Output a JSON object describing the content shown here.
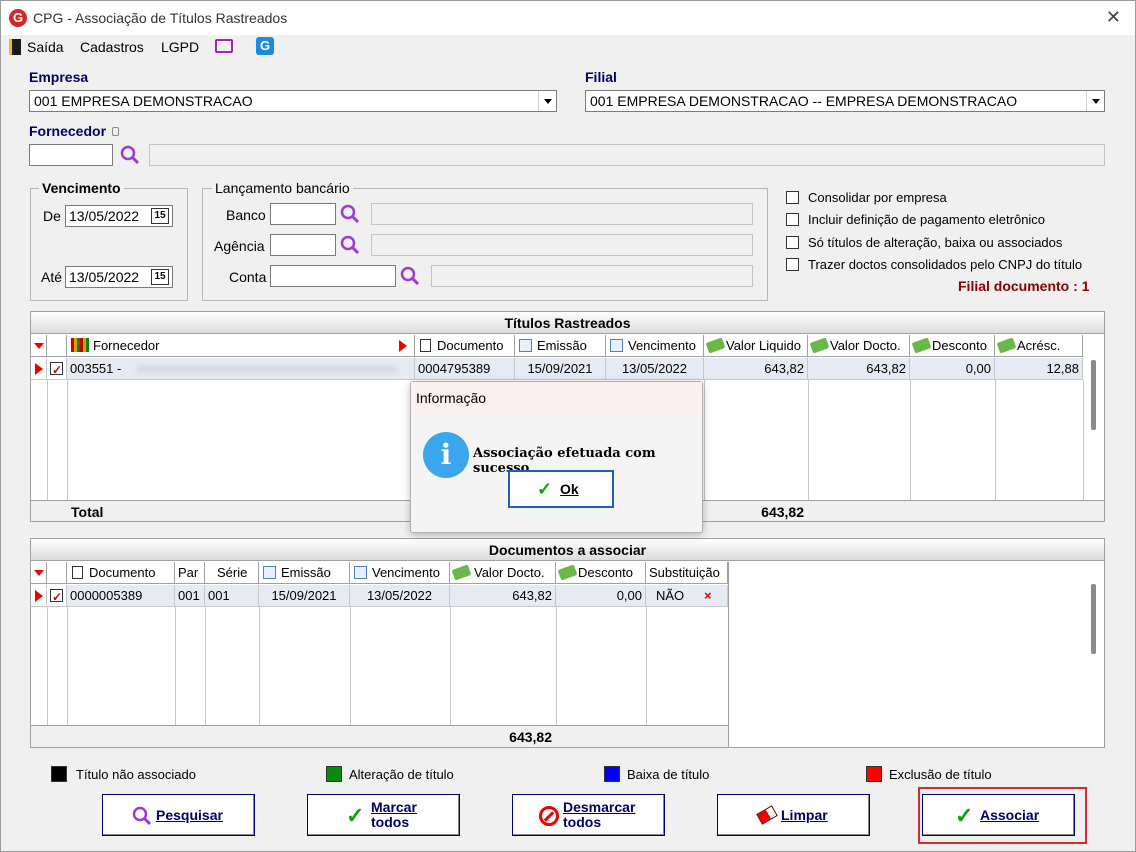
{
  "window": {
    "title": "CPG - Associação de Títulos Rastreados",
    "close": "✕"
  },
  "menu": {
    "items": [
      "Saída",
      "Cadastros",
      "LGPD"
    ]
  },
  "empresa": {
    "label": "Empresa",
    "value": "001 EMPRESA DEMONSTRACAO"
  },
  "filial": {
    "label": "Filial",
    "value": "001 EMPRESA DEMONSTRACAO -- EMPRESA DEMONSTRACAO"
  },
  "fornecedor": {
    "label": "Fornecedor",
    "value": "",
    "name": ""
  },
  "vencimento": {
    "label": "Vencimento",
    "de_label": "De",
    "de_value": "13/05/2022",
    "ate_label": "Até",
    "ate_value": "13/05/2022",
    "cal_icon": "15"
  },
  "lancamento": {
    "label": "Lançamento bancário",
    "banco_label": "Banco",
    "agencia_label": "Agência",
    "conta_label": "Conta"
  },
  "options": [
    {
      "label": "Consolidar por empresa",
      "checked": false
    },
    {
      "label": "Incluir definição de pagamento eletrônico",
      "checked": false
    },
    {
      "label": "Só títulos de alteração, baixa ou associados",
      "checked": false
    },
    {
      "label": "Trazer doctos consolidados pelo CNPJ do título",
      "checked": false
    }
  ],
  "filial_documento": "Filial documento : 1",
  "titulos": {
    "title": "Títulos Rastreados",
    "headers": [
      "Fornecedor",
      "Documento",
      "Emissão",
      "Vencimento",
      "Valor Liquido",
      "Valor Docto.",
      "Desconto",
      "Acrésc."
    ],
    "rows": [
      {
        "fornecedor": "003551 -",
        "documento": "0004795389",
        "emissao": "15/09/2021",
        "vencimento": "13/05/2022",
        "valor_liquido": "643,82",
        "valor_docto": "643,82",
        "desconto": "0,00",
        "acresc": "12,88"
      }
    ],
    "total_label": "Total",
    "total_value": "643,82"
  },
  "documentos": {
    "title": "Documentos a associar",
    "headers": [
      "Documento",
      "Par",
      "Série",
      "Emissão",
      "Vencimento",
      "Valor Docto.",
      "Desconto",
      "Substituição"
    ],
    "rows": [
      {
        "documento": "0000005389",
        "par": "001",
        "serie": "001",
        "emissao": "15/09/2021",
        "vencimento": "13/05/2022",
        "valor_docto": "643,82",
        "desconto": "0,00",
        "substituicao": "NÃO"
      }
    ],
    "total_value": "643,82"
  },
  "legend": [
    {
      "label": "Título não associado",
      "color": "#000000"
    },
    {
      "label": "Alteração de título",
      "color": "#0a8a0a"
    },
    {
      "label": "Baixa de título",
      "color": "#0000ff"
    },
    {
      "label": "Exclusão de título",
      "color": "#ff0000"
    }
  ],
  "buttons": {
    "pesquisar": "Pesquisar",
    "marcar_1": "Marcar",
    "marcar_2": "todos",
    "desmarcar_1": "Desmarcar",
    "desmarcar_2": "todos",
    "limpar": "Limpar",
    "associar": "Associar"
  },
  "dialog": {
    "title": "Informação",
    "message": "Associação efetuada com sucesso",
    "ok": "Ok",
    "icon": "i"
  }
}
